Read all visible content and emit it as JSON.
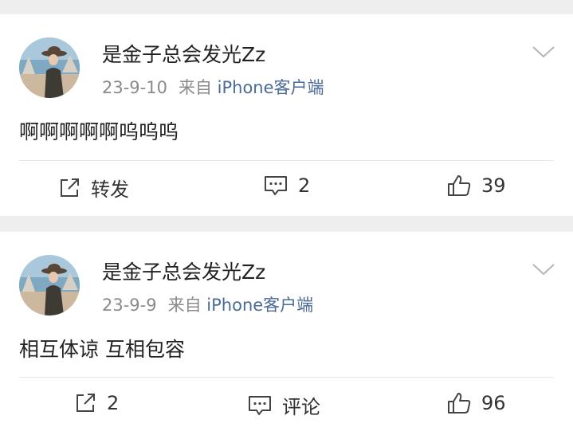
{
  "posts": [
    {
      "username": "是金子总会发光Zz",
      "date": "23-9-10",
      "source_prefix": "来自",
      "source_device": "iPhone客户端",
      "content": "啊啊啊啊啊呜呜呜",
      "actions": {
        "repost": "转发",
        "comment": "2",
        "like": "39"
      }
    },
    {
      "username": "是金子总会发光Zz",
      "date": "23-9-9",
      "source_prefix": "来自",
      "source_device": "iPhone客户端",
      "content": "相互体谅 互相包容",
      "actions": {
        "repost": "2",
        "comment": "评论",
        "like": "96"
      }
    }
  ],
  "icons": {
    "avatar": "avatar-image",
    "more": "chevron-down-icon",
    "repost": "share-icon",
    "comment": "comment-icon",
    "like": "thumbs-up-icon"
  },
  "colors": {
    "username": "#222222",
    "meta": "#8a8a8a",
    "device_link": "#4a6a9a",
    "background": "#eeeeee",
    "card": "#ffffff"
  }
}
